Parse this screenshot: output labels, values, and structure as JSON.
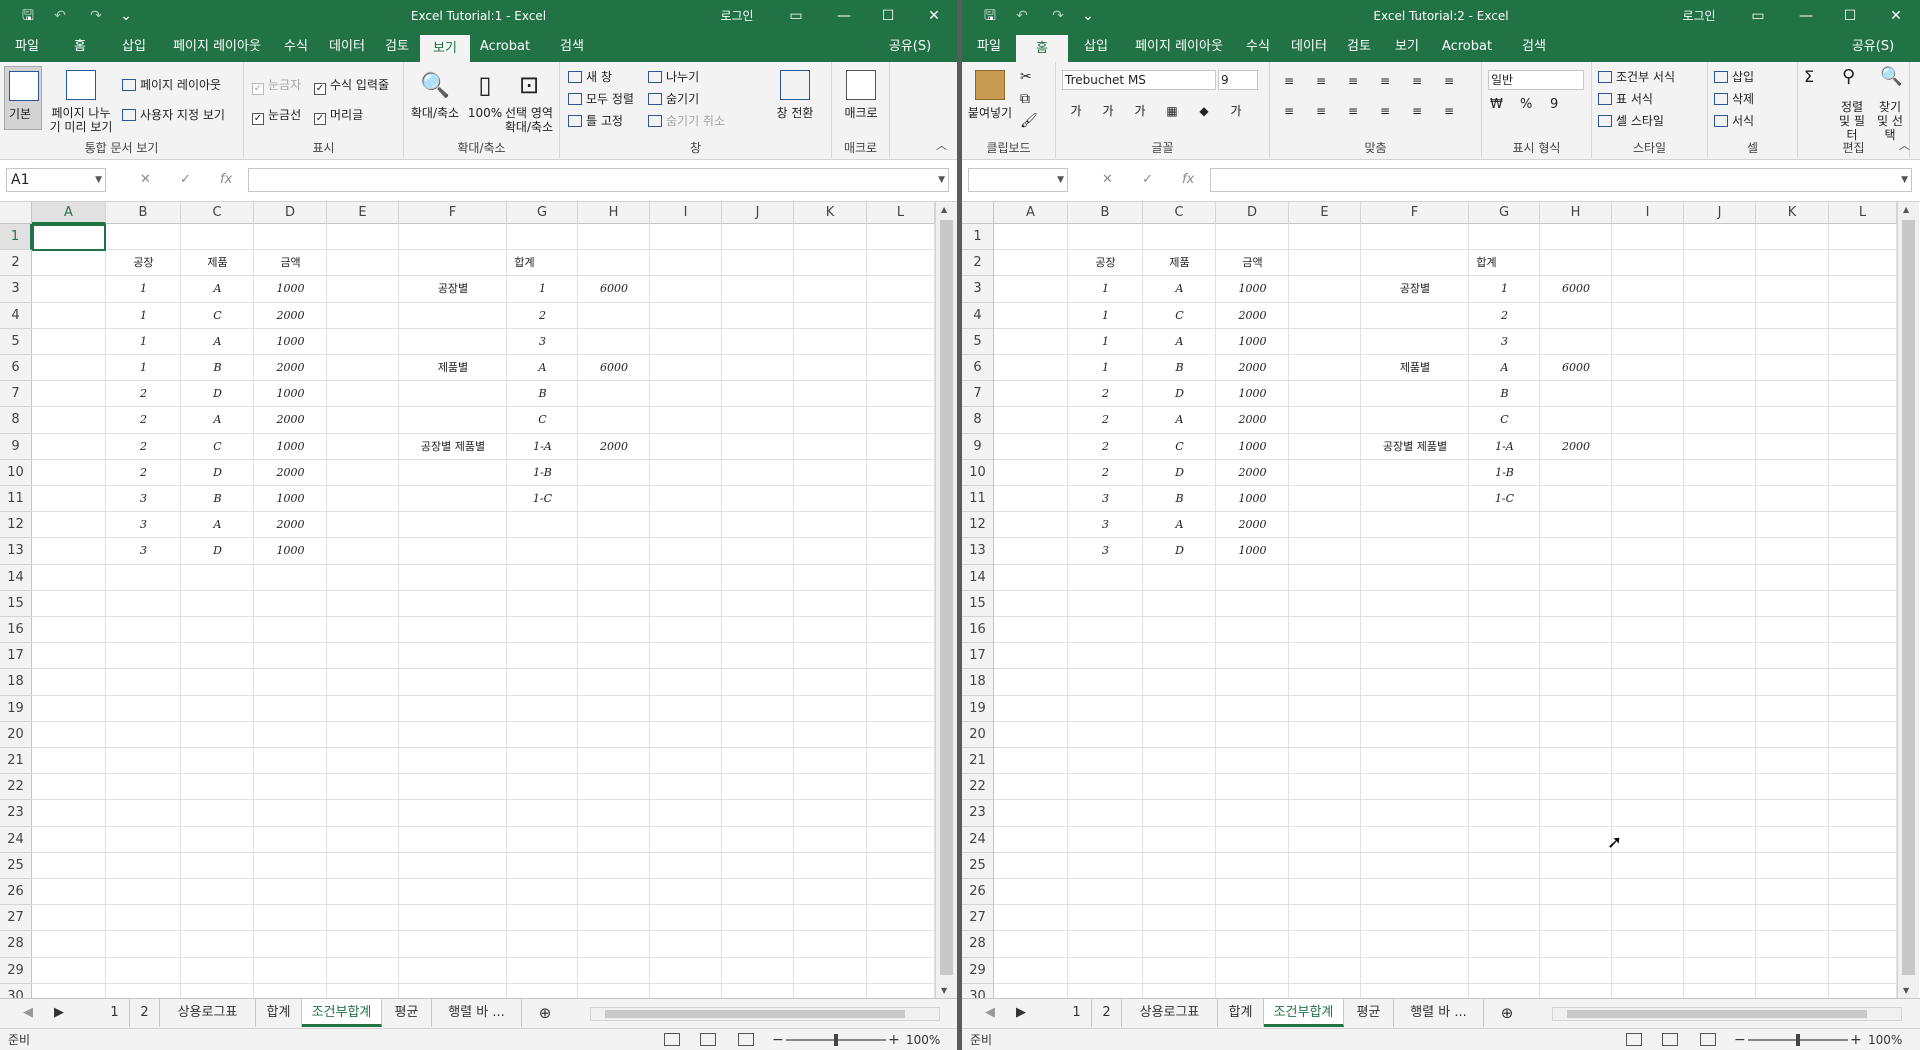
{
  "windows": [
    {
      "title": "Excel Tutorial:1  -  Excel",
      "login": "로그인",
      "active_tab": "보기",
      "tabs": [
        "파일",
        "홈",
        "삽입",
        "페이지 레이아웃",
        "수식",
        "데이터",
        "검토",
        "보기",
        "Acrobat",
        "검색"
      ],
      "share": "공유(S)",
      "name_box": "A1",
      "sheet_tabs": [
        "1",
        "2",
        "상용로그표",
        "합계",
        "조건부합계",
        "평균",
        "행렬 바 ..."
      ],
      "active_sheet": "조건부합계",
      "status": "준비",
      "zoom": "100%"
    },
    {
      "title": "Excel Tutorial:2  -  Excel",
      "login": "로그인",
      "active_tab": "홈",
      "tabs": [
        "파일",
        "홈",
        "삽입",
        "페이지 레이아웃",
        "수식",
        "데이터",
        "검토",
        "보기",
        "Acrobat",
        "검색"
      ],
      "share": "공유(S)",
      "name_box": "",
      "sheet_tabs": [
        "1",
        "2",
        "상용로그표",
        "합계",
        "조건부합계",
        "평균",
        "행렬 바 ..."
      ],
      "active_sheet": "조건부합계",
      "status": "준비",
      "zoom": "100%"
    }
  ],
  "view_ribbon": {
    "normal": "기본",
    "page_break": "페이지 나누기 미리 보기",
    "page_layout": "페이지 레이아웃",
    "custom_view": "사용자 지정 보기",
    "group_workbook_views": "통합 문서 보기",
    "ruler": "눈금자",
    "formula_bar": "수식 입력줄",
    "gridlines": "눈금선",
    "headings": "머리글",
    "group_show": "표시",
    "zoom": "확대/축소",
    "zoom100": "100%",
    "zoom_selection": "선택 영역 확대/축소",
    "group_zoom": "확대/축소",
    "new_window": "새 창",
    "arrange_all": "모두 정렬",
    "freeze_panes": "틀 고정",
    "split": "나누기",
    "hide": "숨기기",
    "unhide": "숨기기 취소",
    "switch_windows": "창 전환",
    "group_window": "창",
    "macros": "매크로",
    "group_macros": "매크로"
  },
  "home_ribbon": {
    "paste": "붙여넣기",
    "group_clipboard": "클립보드",
    "font_name": "Trebuchet MS",
    "font_size": "9",
    "group_font": "글꼴",
    "group_align": "맞춤",
    "number_format": "일반",
    "group_number": "표시 형식",
    "conditional_format": "조건부 서식",
    "format_table": "표 서식",
    "cell_styles": "셀 스타일",
    "group_styles": "스타일",
    "insert": "삽입",
    "delete": "삭제",
    "format": "서식",
    "group_cells": "셀",
    "sort_filter": "정렬 및 필터",
    "find_select": "찾기 및 선택",
    "group_editing": "편집"
  },
  "columns": [
    "A",
    "B",
    "C",
    "D",
    "E",
    "F",
    "G",
    "H",
    "I",
    "J",
    "K",
    "L"
  ],
  "rows": [
    "1",
    "2",
    "3",
    "4",
    "5",
    "6",
    "7",
    "8",
    "9",
    "10",
    "11",
    "12",
    "13",
    "14",
    "15",
    "16",
    "17",
    "18",
    "19",
    "20",
    "21",
    "22",
    "23",
    "24",
    "25",
    "26",
    "27",
    "28",
    "29",
    "30"
  ],
  "sheet": {
    "headers": {
      "factory": "공장",
      "product": "제품",
      "amount": "금액",
      "total": "합계"
    },
    "data": [
      [
        "1",
        "A",
        "1000"
      ],
      [
        "1",
        "C",
        "2000"
      ],
      [
        "1",
        "A",
        "1000"
      ],
      [
        "1",
        "B",
        "2000"
      ],
      [
        "2",
        "D",
        "1000"
      ],
      [
        "2",
        "A",
        "2000"
      ],
      [
        "2",
        "C",
        "1000"
      ],
      [
        "2",
        "D",
        "2000"
      ],
      [
        "3",
        "B",
        "1000"
      ],
      [
        "3",
        "A",
        "2000"
      ],
      [
        "3",
        "D",
        "1000"
      ]
    ],
    "summary": [
      {
        "label": "공장별",
        "key": "1",
        "value": "6000"
      },
      {
        "label": "",
        "key": "2",
        "value": ""
      },
      {
        "label": "",
        "key": "3",
        "value": ""
      },
      {
        "label": "제품별",
        "key": "A",
        "value": "6000"
      },
      {
        "label": "",
        "key": "B",
        "value": ""
      },
      {
        "label": "",
        "key": "C",
        "value": ""
      },
      {
        "label": "공장별 제품별",
        "key": "1-A",
        "value": "2000"
      },
      {
        "label": "",
        "key": "1-B",
        "value": ""
      },
      {
        "label": "",
        "key": "1-C",
        "value": ""
      }
    ]
  }
}
